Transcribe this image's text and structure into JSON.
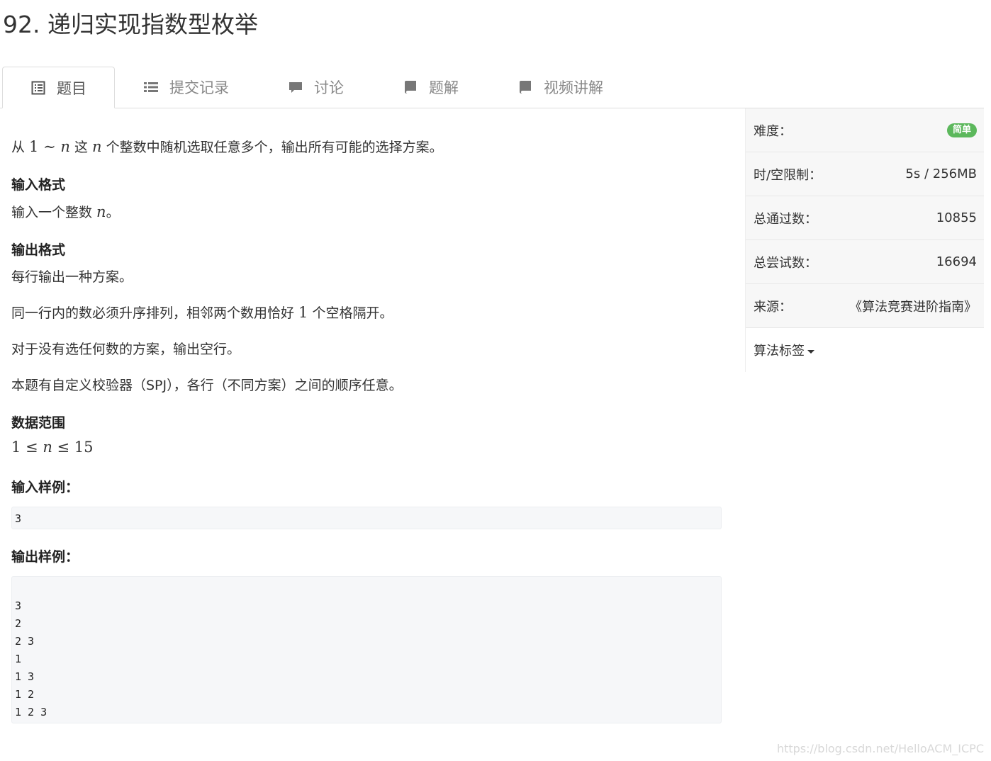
{
  "page_title": "92. 递归实现指数型枚举",
  "tabs": [
    {
      "label": "题目",
      "icon": "list-alt-icon",
      "active": true
    },
    {
      "label": "提交记录",
      "icon": "list-icon",
      "active": false
    },
    {
      "label": "讨论",
      "icon": "comment-icon",
      "active": false
    },
    {
      "label": "题解",
      "icon": "book-icon",
      "active": false
    },
    {
      "label": "视频讲解",
      "icon": "book-icon",
      "active": false
    }
  ],
  "problem": {
    "desc_part1": "从 ",
    "desc_math1": "1",
    "desc_tilde": " ∼ ",
    "desc_n1": "n",
    "desc_part2": " 这 ",
    "desc_n2": "n",
    "desc_part3": " 个整数中随机选取任意多个，输出所有可能的选择方案。",
    "input_format_heading": "输入格式",
    "input_format_text": "输入一个整数 ",
    "input_format_n": "n",
    "input_format_end": "。",
    "output_format_heading": "输出格式",
    "output_line1": "每行输出一种方案。",
    "output_line2_a": "同一行内的数必须升序排列，相邻两个数用恰好 ",
    "output_line2_num": "1",
    "output_line2_b": " 个空格隔开。",
    "output_line3": "对于没有选任何数的方案，输出空行。",
    "output_line4": "本题有自定义校验器（SPJ），各行（不同方案）之间的顺序任意。",
    "range_heading": "数据范围",
    "range_a": "1",
    "range_le1": " ≤ ",
    "range_n": "n",
    "range_le2": " ≤ ",
    "range_b": "15",
    "sample_input_heading": "输入样例：",
    "sample_input": "3",
    "sample_output_heading": "输出样例：",
    "sample_output_lines": [
      "",
      "3",
      "2",
      "2 3",
      "1",
      "1 3",
      "1 2",
      "1 2 3"
    ]
  },
  "sidebar": {
    "difficulty_label": "难度：",
    "difficulty_value": "简单",
    "limit_label": "时/空限制：",
    "limit_value": "5s / 256MB",
    "passed_label": "总通过数：",
    "passed_value": "10855",
    "attempts_label": "总尝试数：",
    "attempts_value": "16694",
    "source_label": "来源：",
    "source_value": "《算法竞赛进阶指南》",
    "tags_label": "算法标签"
  },
  "colors": {
    "badge": "#5cb85c",
    "code_bg": "#f6f7f9",
    "sidebar_bg": "#f7f7f7"
  },
  "watermark": "https://blog.csdn.net/HelloACM_ICPC"
}
